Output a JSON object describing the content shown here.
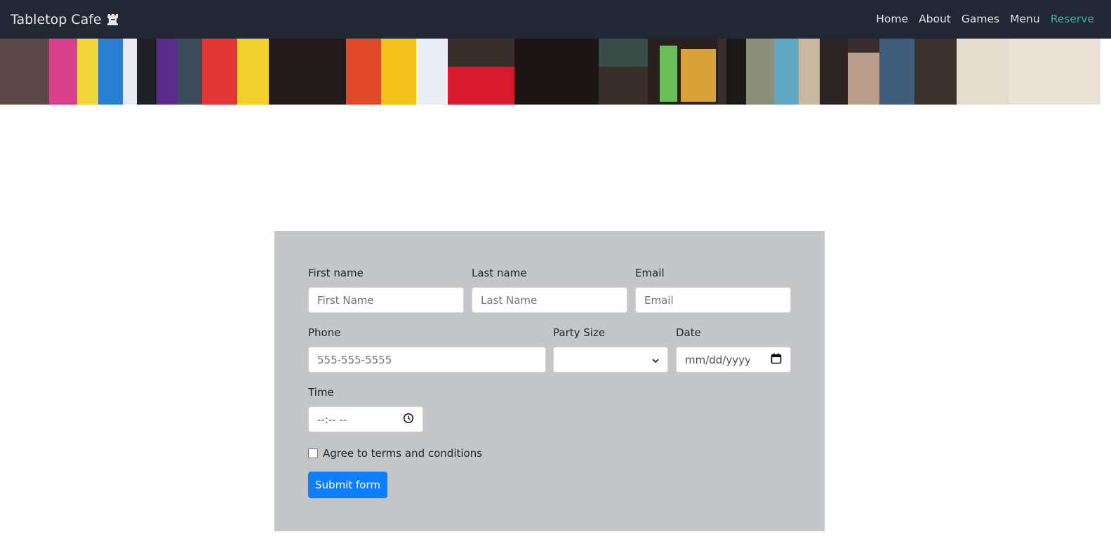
{
  "nav": {
    "brand": "Tabletop Cafe",
    "links": [
      {
        "label": "Home",
        "active": false
      },
      {
        "label": "About",
        "active": false
      },
      {
        "label": "Games",
        "active": false
      },
      {
        "label": "Menu",
        "active": false
      },
      {
        "label": "Reserve",
        "active": true
      }
    ]
  },
  "form": {
    "first_name": {
      "label": "First name",
      "placeholder": "First Name",
      "value": ""
    },
    "last_name": {
      "label": "Last name",
      "placeholder": "Last Name",
      "value": ""
    },
    "email": {
      "label": "Email",
      "placeholder": "Email",
      "value": ""
    },
    "phone": {
      "label": "Phone",
      "placeholder": "555-555-5555",
      "value": ""
    },
    "party_size": {
      "label": "Party Size",
      "selected": ""
    },
    "date": {
      "label": "Date",
      "display": "mm/dd/yyyy"
    },
    "time": {
      "label": "Time",
      "display": "--:-- --"
    },
    "terms": {
      "label": "Agree to terms and conditions",
      "checked": false
    },
    "submit_label": "Submit form"
  },
  "colors": {
    "navbar_bg": "#212733",
    "active_link": "#35b3a4",
    "panel_bg": "#c5c6c8",
    "primary_button": "#0d7efd"
  }
}
